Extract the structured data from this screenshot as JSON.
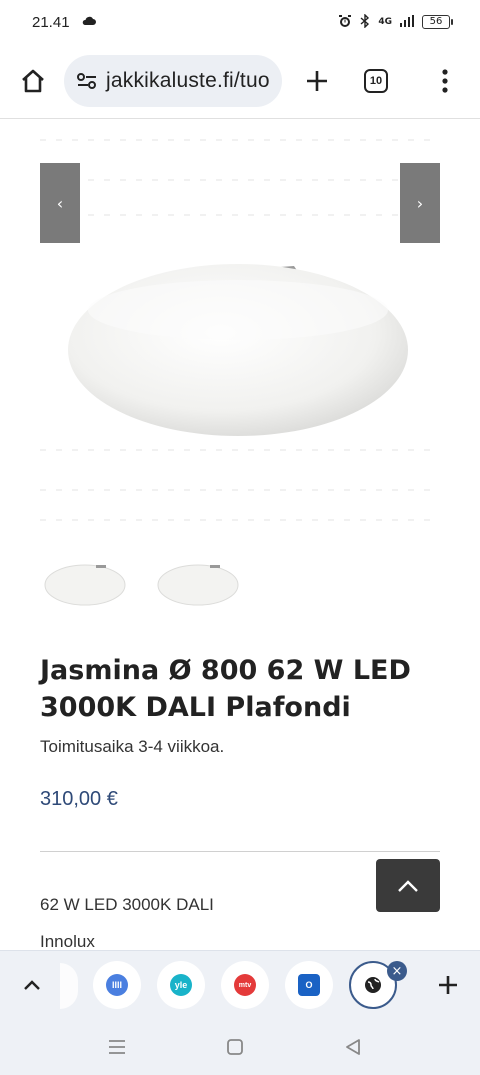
{
  "status": {
    "time": "21.41",
    "network": "4G",
    "battery": "56"
  },
  "browser": {
    "url": "jakkikaluste.fi/tuo",
    "tab_count": "10"
  },
  "gallery": {
    "prev_symbol": "‹",
    "next_symbol": "›"
  },
  "product": {
    "title": "Jasmina Ø 800 62 W LED 3000K DALI Plafondi",
    "delivery": "Toimitusaika 3-4 viikkoa.",
    "price": "310,00 €",
    "spec_line_1": "62 W LED 3000K DALI",
    "brand": "Innolux"
  },
  "tab_strip": {
    "tabs": [
      {
        "icon": "yle-areena-icon",
        "color": "#4a7fe0",
        "label": "IIII"
      },
      {
        "icon": "yle-icon",
        "color": "#19b3c9",
        "label": "yle"
      },
      {
        "icon": "mtv-icon",
        "color": "#e43a3a",
        "label": "mtv"
      },
      {
        "icon": "outlook-icon",
        "color": "#1a62c4",
        "label": "O"
      },
      {
        "icon": "globe-icon",
        "color": "#222222",
        "label": ""
      }
    ]
  },
  "colors": {
    "price": "#2f4a78",
    "accent": "#3b5b8c",
    "gallery_arrow": "#7a7a7a",
    "scroll_top_bg": "#3a3a3a"
  }
}
